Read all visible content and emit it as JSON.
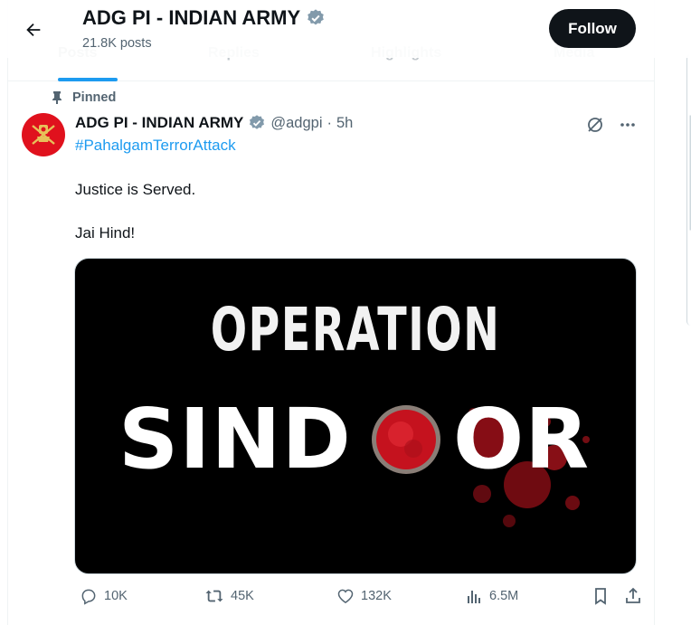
{
  "header": {
    "title": "ADG PI - INDIAN ARMY",
    "posts_count": "21.8K posts",
    "follow_label": "Follow"
  },
  "tabs": [
    {
      "label": "Posts"
    },
    {
      "label": "Replies"
    },
    {
      "label": "Highlights"
    },
    {
      "label": "Media"
    }
  ],
  "tweet": {
    "pinned_label": "Pinned",
    "author_name": "ADG PI - INDIAN ARMY",
    "handle": "@adgpi",
    "separator": "·",
    "time": "5h",
    "hashtag": "#PahalgamTerrorAttack",
    "line1": "Justice is Served.",
    "line2": "Jai Hind!",
    "media": {
      "word_top": "OPERATION",
      "word_left": "SIND",
      "word_right": "OR"
    },
    "stats": {
      "replies": "10K",
      "reposts": "45K",
      "likes": "132K",
      "views": "6.5M"
    }
  },
  "colors": {
    "accent": "#1d9bf0",
    "verified": "#829aab",
    "text": "#0f1419",
    "muted": "#536471",
    "sindoor_red": "#d9202a"
  },
  "icons": [
    "back-arrow-icon",
    "verified-badge-icon",
    "pin-icon",
    "grok-icon",
    "more-icon",
    "reply-icon",
    "repost-icon",
    "like-icon",
    "views-icon",
    "bookmark-icon",
    "share-icon"
  ]
}
